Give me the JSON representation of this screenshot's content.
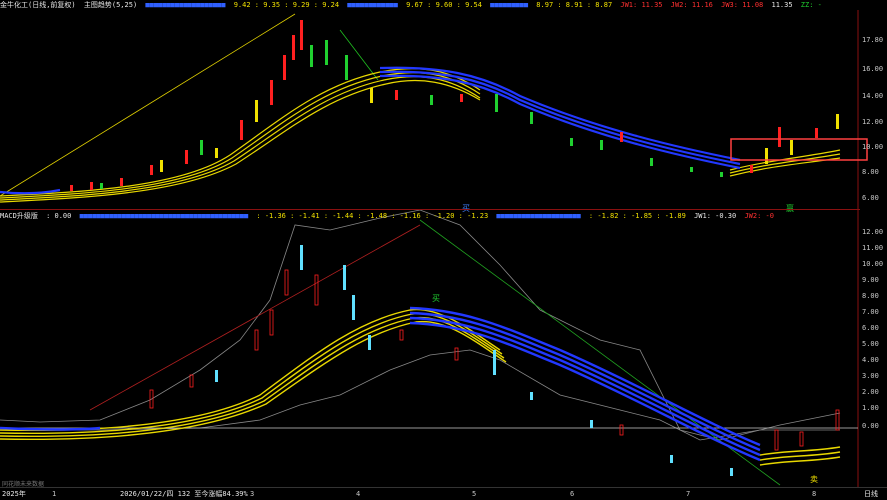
{
  "top_info": {
    "stock": "金牛化工(日线,前复权)",
    "indicator": "主图趋势(5,25)",
    "vals_a": "9.42 : 9.35 : 9.29 : 9.24",
    "vals_b": "9.67 : 9.60 : 9.54",
    "vals_c": "8.97 : 8.91 : 8.87",
    "jw1": "JW1: 11.35",
    "jw2": "JW2: 11.16",
    "jw3": "JW3: 11.08",
    "last": "11.35",
    "zz": "ZZ: -"
  },
  "macd_info": {
    "name": "MACD升级版",
    "v0": ": 0.00",
    "vals_a": ": -1.36 : -1.41 : -1.44 : -1.48 : -1.16 : -1.20 : -1.23",
    "vals_b": ": -1.82 : -1.85 : -1.89",
    "jw1": "JW1: -0.30",
    "jw2": "JW2: -0"
  },
  "top_axis": [
    "17.80",
    "16.00",
    "14.00",
    "12.00",
    "10.00",
    "8.00",
    "6.00"
  ],
  "bottom_axis": [
    "12.00",
    "11.00",
    "10.00",
    "9.00",
    "8.00",
    "7.00",
    "6.00",
    "5.00",
    "4.00",
    "3.00",
    "2.00",
    "1.00",
    "0.00"
  ],
  "footer": {
    "year": "2025年",
    "months": [
      "1",
      "2",
      "3",
      "4",
      "5",
      "6",
      "7",
      "8"
    ],
    "date_note": "2026/01/22/四 132  至今涨幅84.39%",
    "right": "日线",
    "watermark": "同花顺未来数据"
  },
  "markers": {
    "buy_top": "买",
    "buy_bottom": "买",
    "tag": "赢",
    "sell": "卖"
  },
  "colors": {
    "up": "#ff2020",
    "down": "#20d030",
    "yellow": "#f0e000",
    "blue": "#2040ff",
    "highlight": "#ff4040"
  }
}
